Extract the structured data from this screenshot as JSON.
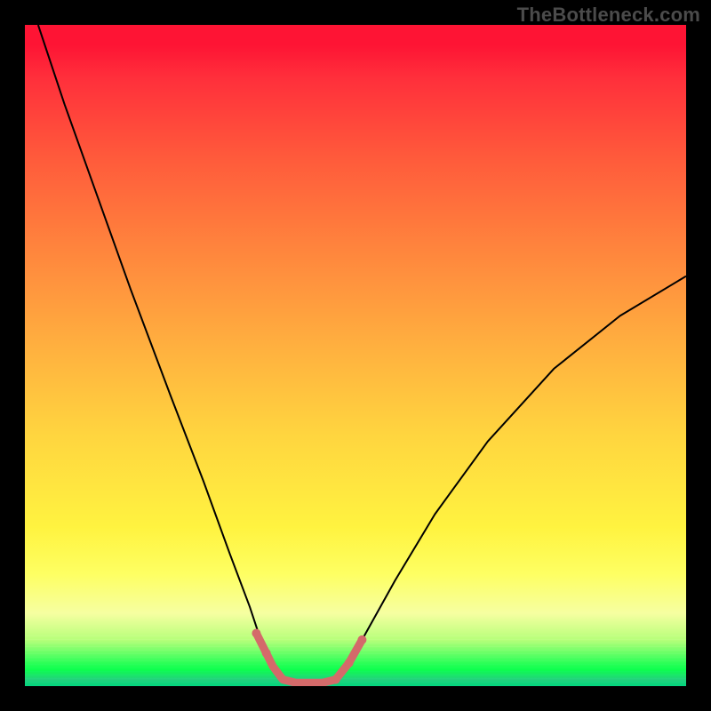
{
  "watermark": "TheBottleneck.com",
  "chart_data": {
    "type": "line",
    "title": "",
    "xlabel": "",
    "ylabel": "",
    "xlim": [
      0,
      100
    ],
    "ylim": [
      0,
      100
    ],
    "background": "rainbow-vertical-gradient",
    "gradient_stops": [
      {
        "pos": 0,
        "color": "#fe1434"
      },
      {
        "pos": 0.2,
        "color": "#ff5a3b"
      },
      {
        "pos": 0.48,
        "color": "#ffae3f"
      },
      {
        "pos": 0.76,
        "color": "#fff340"
      },
      {
        "pos": 0.93,
        "color": "#b7ff7a"
      },
      {
        "pos": 1.0,
        "color": "#00d47b"
      }
    ],
    "series": [
      {
        "name": "bottleneck-curve",
        "stroke": "#000000",
        "stroke_width": 2,
        "points": [
          {
            "x": 2,
            "y": 100
          },
          {
            "x": 6,
            "y": 88
          },
          {
            "x": 11,
            "y": 74
          },
          {
            "x": 16,
            "y": 60
          },
          {
            "x": 22,
            "y": 44
          },
          {
            "x": 27,
            "y": 31
          },
          {
            "x": 31,
            "y": 20
          },
          {
            "x": 34,
            "y": 12
          },
          {
            "x": 36,
            "y": 6
          },
          {
            "x": 38,
            "y": 2
          },
          {
            "x": 40,
            "y": 0.5
          },
          {
            "x": 43,
            "y": 0.5
          },
          {
            "x": 46,
            "y": 0.5
          },
          {
            "x": 48,
            "y": 2
          },
          {
            "x": 51,
            "y": 7
          },
          {
            "x": 56,
            "y": 16
          },
          {
            "x": 62,
            "y": 26
          },
          {
            "x": 70,
            "y": 37
          },
          {
            "x": 80,
            "y": 48
          },
          {
            "x": 90,
            "y": 56
          },
          {
            "x": 100,
            "y": 62
          }
        ]
      },
      {
        "name": "optimal-zone-highlight",
        "stroke": "#d46a6a",
        "stroke_width": 9,
        "linecap": "round",
        "points": [
          {
            "x": 35,
            "y": 8
          },
          {
            "x": 36.5,
            "y": 5
          },
          {
            "x": 37.5,
            "y": 3
          },
          {
            "x": 39,
            "y": 1
          },
          {
            "x": 41,
            "y": 0.5
          },
          {
            "x": 43,
            "y": 0.5
          },
          {
            "x": 45,
            "y": 0.5
          },
          {
            "x": 47,
            "y": 1
          },
          {
            "x": 49,
            "y": 3.5
          },
          {
            "x": 51,
            "y": 7
          }
        ]
      }
    ],
    "highlight_dots": {
      "color": "#d46a6a",
      "radius": 5,
      "points": [
        {
          "x": 35,
          "y": 8
        },
        {
          "x": 36.5,
          "y": 5
        },
        {
          "x": 47,
          "y": 1
        },
        {
          "x": 49,
          "y": 3.5
        },
        {
          "x": 51,
          "y": 7
        }
      ]
    }
  }
}
